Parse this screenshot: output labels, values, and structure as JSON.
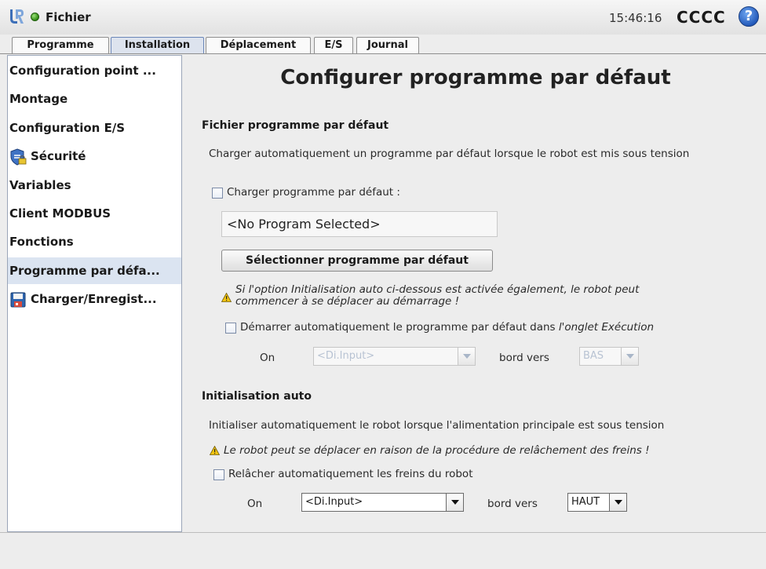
{
  "header": {
    "app_title": "Fichier",
    "clock": "15:46:16",
    "robot_name": "CCCC",
    "help_label": "?"
  },
  "tabs": [
    {
      "label": "Programme"
    },
    {
      "label": "Installation"
    },
    {
      "label": "Déplacement"
    },
    {
      "label": "E/S"
    },
    {
      "label": "Journal"
    }
  ],
  "active_tab": "Installation",
  "sidebar": {
    "items": [
      {
        "label": "Configuration point ..."
      },
      {
        "label": "Montage"
      },
      {
        "label": "Configuration E/S"
      },
      {
        "label": "Sécurité",
        "icon": "shield-lock-icon"
      },
      {
        "label": "Variables"
      },
      {
        "label": "Client MODBUS"
      },
      {
        "label": "Fonctions"
      },
      {
        "label": "Programme par défa..."
      },
      {
        "label": "Charger/Enregist...",
        "icon": "floppy-disk-icon"
      }
    ],
    "selected": "Programme par défa..."
  },
  "main": {
    "title": "Configurer programme par défaut",
    "default_file": {
      "section_title": "Fichier programme par défaut",
      "description": "Charger automatiquement un programme par défaut lorsque le robot est mis sous tension",
      "load_checkbox_label": "Charger programme par défaut :",
      "load_checked": false,
      "program_value": "<No Program Selected>",
      "select_button": "Sélectionner programme par défaut",
      "warning_line1": "Si l'option Initialisation auto ci-dessous est activée également, le robot peut",
      "warning_line2": "commencer à se déplacer au démarrage !",
      "autostart_label": "Démarrer automatiquement le programme par défaut dans ",
      "autostart_label_italic": "l'onglet Exécution",
      "autostart_checked": false,
      "on_label": "On",
      "input_select": "<Di.Input>",
      "edge_label": "bord vers",
      "edge_select": "BAS"
    },
    "auto_init": {
      "section_title": "Initialisation auto",
      "description": "Initialiser automatiquement le robot lorsque l'alimentation principale est sous tension",
      "warning": "Le robot peut se déplacer en raison de la procédure de relâchement des freins !",
      "brake_label": "Relâcher automatiquement les freins du robot",
      "brake_checked": false,
      "on_label": "On",
      "input_select": "<Di.Input>",
      "edge_label": "bord vers",
      "edge_select": "HAUT"
    }
  },
  "colors": {
    "selected_row": "#dbe4f1",
    "active_tab": "#dde3ee",
    "warning": "#f2c40f",
    "help": "#1f56b8",
    "status_ok": "#2f8a12"
  }
}
